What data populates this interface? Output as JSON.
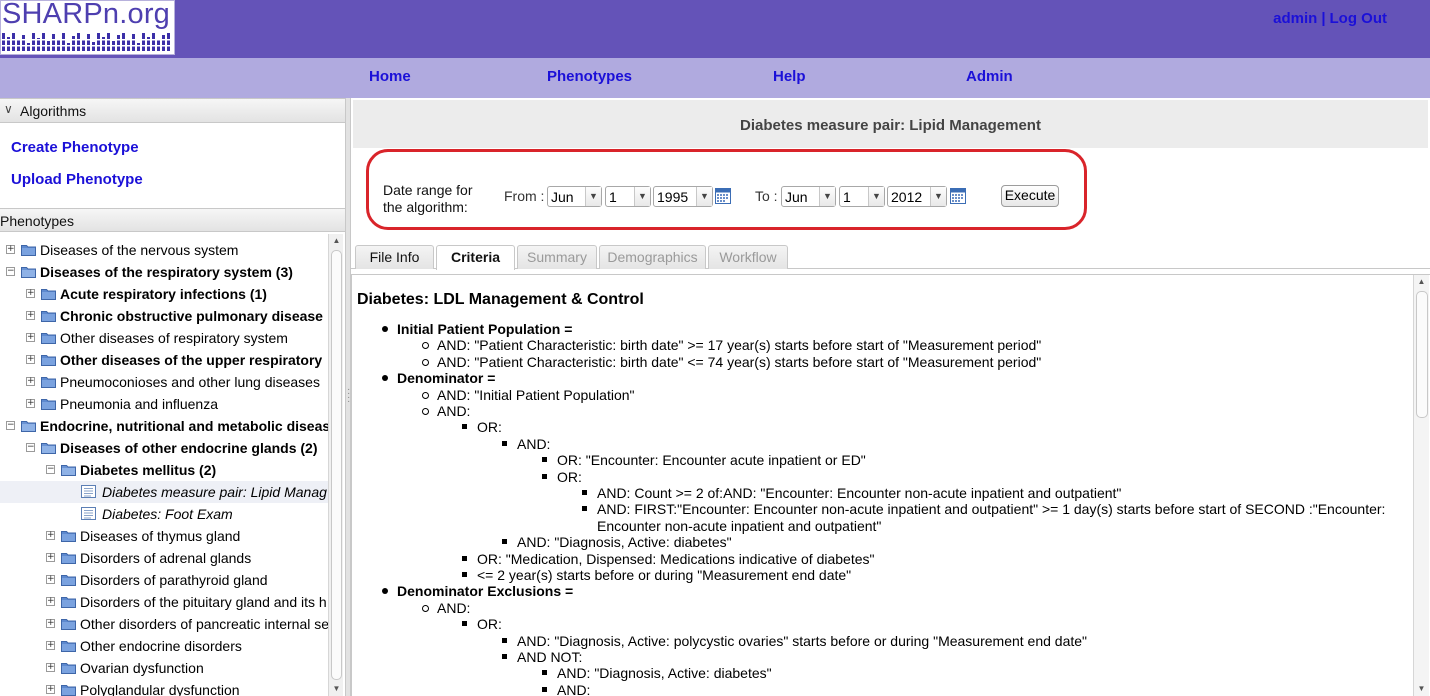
{
  "header": {
    "logo_text": "SHARPn.org",
    "user": {
      "admin": "admin",
      "separator": "|",
      "logout": "Log Out"
    }
  },
  "nav": [
    "Home",
    "Phenotypes",
    "Help",
    "Admin"
  ],
  "left_panel": {
    "algorithms_header": "Algorithms",
    "create_label": "Create Phenotype",
    "upload_label": "Upload Phenotype",
    "phenotypes_header": "Phenotypes",
    "tree": [
      {
        "label": "Diseases of the nervous system",
        "bold": false
      },
      {
        "label": "Diseases of the respiratory system (3)",
        "bold": true
      },
      {
        "label": "Acute respiratory infections (1)",
        "bold": true
      },
      {
        "label": "Chronic obstructive pulmonary disease",
        "bold": true
      },
      {
        "label": "Other diseases of respiratory system",
        "bold": false
      },
      {
        "label": "Other diseases of the upper respiratory",
        "bold": true
      },
      {
        "label": "Pneumoconioses and other lung diseases",
        "bold": false
      },
      {
        "label": "Pneumonia and influenza",
        "bold": false
      },
      {
        "label": "Endocrine, nutritional and metabolic diseas",
        "bold": true
      },
      {
        "label": "Diseases of other endocrine glands (2)",
        "bold": true
      },
      {
        "label": "Diabetes mellitus (2)",
        "bold": true
      },
      {
        "label": "Diabetes measure pair: Lipid Manag",
        "bold": false
      },
      {
        "label": "Diabetes: Foot Exam",
        "bold": false
      },
      {
        "label": "Diseases of thymus gland",
        "bold": false
      },
      {
        "label": "Disorders of adrenal glands",
        "bold": false
      },
      {
        "label": "Disorders of parathyroid gland",
        "bold": false
      },
      {
        "label": "Disorders of the pituitary gland and its h",
        "bold": false
      },
      {
        "label": "Other disorders of pancreatic internal se",
        "bold": false
      },
      {
        "label": "Other endocrine disorders",
        "bold": false
      },
      {
        "label": "Ovarian dysfunction",
        "bold": false
      },
      {
        "label": "Polyglandular dysfunction",
        "bold": false
      }
    ]
  },
  "main": {
    "title": "Diabetes measure pair: Lipid Management",
    "date_range": {
      "label_line1": "Date range for",
      "label_line2": "the algorithm:",
      "from_label": "From :",
      "from_month": "Jun",
      "from_day": "1",
      "from_year": "1995",
      "to_label": "To :",
      "to_month": "Jun",
      "to_day": "1",
      "to_year": "2012",
      "execute_label": "Execute"
    },
    "tabs": [
      {
        "label": "File Info",
        "state": "normal"
      },
      {
        "label": "Criteria",
        "state": "active"
      },
      {
        "label": "Summary",
        "state": "disabled"
      },
      {
        "label": "Demographics",
        "state": "disabled"
      },
      {
        "label": "Workflow",
        "state": "disabled"
      }
    ],
    "content_title": "Diabetes: LDL Management & Control",
    "criteria_lines": [
      "Initial Patient Population =",
      "AND: \"Patient Characteristic: birth date\" >= 17 year(s) starts before start of \"Measurement period\"",
      "AND: \"Patient Characteristic: birth date\" <= 74 year(s) starts before start of \"Measurement period\"",
      "Denominator =",
      "AND: \"Initial Patient Population\"",
      "AND:",
      "OR:",
      "AND:",
      "OR: \"Encounter: Encounter acute inpatient or ED\"",
      "OR:",
      "AND: Count >= 2 of:AND: \"Encounter: Encounter non-acute inpatient and outpatient\"",
      "AND: FIRST:\"Encounter: Encounter non-acute inpatient and outpatient\" >= 1 day(s) starts before start of SECOND :\"Encounter:",
      "Encounter non-acute inpatient and outpatient\"",
      "AND: \"Diagnosis, Active: diabetes\"",
      "OR: \"Medication, Dispensed: Medications indicative of diabetes\"",
      "<= 2 year(s) starts before or during \"Measurement end date\"",
      "Denominator Exclusions =",
      "AND:",
      "OR:",
      "AND: \"Diagnosis, Active: polycystic ovaries\" starts before or during \"Measurement end date\"",
      "AND NOT:",
      "AND: \"Diagnosis, Active: diabetes\"",
      "AND:"
    ]
  },
  "colors": {
    "header_bg": "#6453b8",
    "nav_bg": "#b0aadf",
    "link": "#1b10d8",
    "highlight_box": "#d9242a"
  }
}
